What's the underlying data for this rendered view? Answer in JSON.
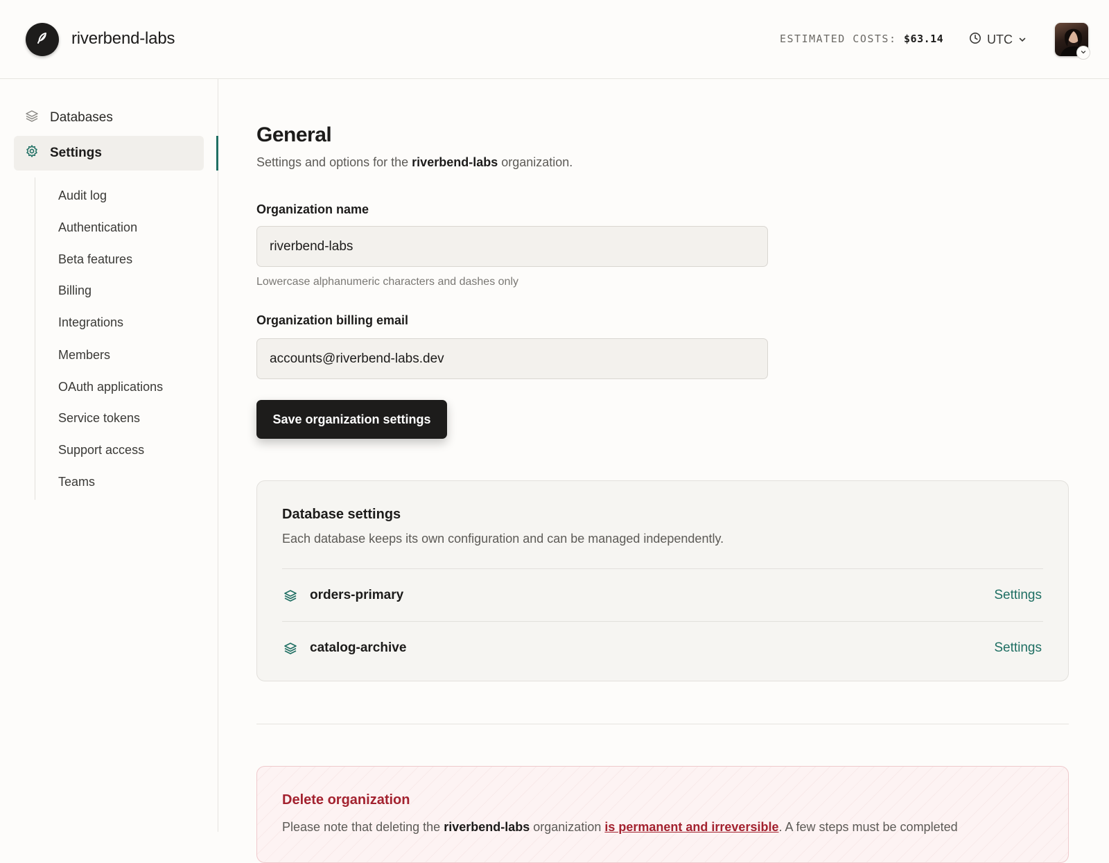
{
  "header": {
    "org_name": "riverbend-labs",
    "logo_icon": "feather-icon",
    "costs_label": "ESTIMATED COSTS:",
    "costs_value": "$63.14",
    "timezone": "UTC"
  },
  "sidebar": {
    "primary": [
      {
        "label": "Databases",
        "icon": "layers-icon",
        "active": false
      },
      {
        "label": "Settings",
        "icon": "gear-icon",
        "active": true
      }
    ],
    "sub_items": [
      "Audit log",
      "Authentication",
      "Beta features",
      "Billing",
      "Integrations",
      "Members",
      "OAuth applications",
      "Service tokens",
      "Support access",
      "Teams"
    ]
  },
  "main": {
    "title": "General",
    "subtitle_pre": "Settings and options for the",
    "subtitle_org": "riverbend-labs",
    "subtitle_post": "organization.",
    "org_name_label": "Organization name",
    "org_name_value": "riverbend-labs",
    "org_name_hint": "Lowercase alphanumeric characters and dashes only",
    "billing_email_label": "Organization billing email",
    "billing_email_value": "accounts@riverbend-labs.dev",
    "save_label": "Save organization settings"
  },
  "database_settings": {
    "title": "Database settings",
    "description": "Each database keeps its own configuration and can be managed independently.",
    "databases": [
      {
        "name": "orders-primary",
        "link": "Settings"
      },
      {
        "name": "catalog-archive",
        "link": "Settings"
      }
    ]
  },
  "danger_zone": {
    "title": "Delete organization",
    "text_pre": "Please note that deleting the",
    "text_org": "riverbend-labs",
    "text_mid": "organization",
    "text_warning": "is permanent and irreversible",
    "text_post": ". A few steps must be completed"
  },
  "colors": {
    "accent": "#1f6f63",
    "danger": "#a3222f",
    "primary_button": "#1d1c1b"
  }
}
